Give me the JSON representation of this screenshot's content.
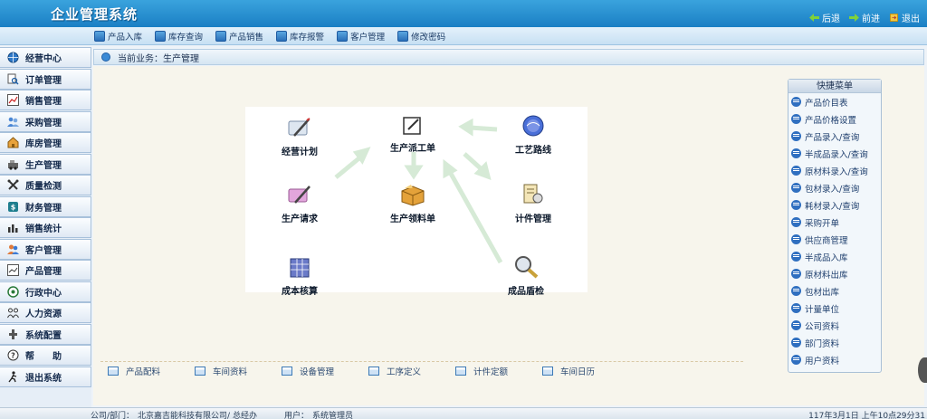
{
  "app": {
    "title": "企业管理系统"
  },
  "topnav": [
    {
      "label": "后退",
      "icon": "back-arrow-icon"
    },
    {
      "label": "前进",
      "icon": "forward-arrow-icon"
    },
    {
      "label": "退出",
      "icon": "exit-icon"
    }
  ],
  "toolbar": [
    {
      "label": "产品入库",
      "icon": "stock-in-icon"
    },
    {
      "label": "库存查询",
      "icon": "inventory-search-icon"
    },
    {
      "label": "产品销售",
      "icon": "sales-icon"
    },
    {
      "label": "库存报警",
      "icon": "inventory-alarm-icon"
    },
    {
      "label": "客户管理",
      "icon": "customer-icon"
    },
    {
      "label": "修改密码",
      "icon": "key-icon"
    }
  ],
  "sidebar": [
    {
      "label": "经营中心",
      "icon": "globe-icon"
    },
    {
      "label": "订单管理",
      "icon": "order-search-icon"
    },
    {
      "label": "销售管理",
      "icon": "sales-chart-icon"
    },
    {
      "label": "采购管理",
      "icon": "purchase-users-icon"
    },
    {
      "label": "库房管理",
      "icon": "warehouse-icon"
    },
    {
      "label": "生产管理",
      "icon": "production-icon"
    },
    {
      "label": "质量检测",
      "icon": "quality-check-icon"
    },
    {
      "label": "财务管理",
      "icon": "finance-icon"
    },
    {
      "label": "销售统计",
      "icon": "bar-chart-icon"
    },
    {
      "label": "客户管理",
      "icon": "customers-icon"
    },
    {
      "label": "产品管理",
      "icon": "product-chart-icon"
    },
    {
      "label": "行政中心",
      "icon": "admin-icon"
    },
    {
      "label": "人力资源",
      "icon": "hr-icon"
    },
    {
      "label": "系统配置",
      "icon": "config-icon"
    },
    {
      "label": "帮　　助",
      "icon": "help-icon"
    },
    {
      "label": "退出系统",
      "icon": "logout-icon"
    }
  ],
  "breadcrumb": {
    "prefix": "当前业务：",
    "current": "生产管理"
  },
  "flow": [
    {
      "label": "经营计划",
      "icon": "business-plan-icon"
    },
    {
      "label": "生产派工单",
      "icon": "dispatch-order-icon"
    },
    {
      "label": "工艺路线",
      "icon": "process-route-icon"
    },
    {
      "label": "生产请求",
      "icon": "production-request-icon"
    },
    {
      "label": "生产领料单",
      "icon": "material-requisition-icon"
    },
    {
      "label": "计件管理",
      "icon": "piecework-icon"
    },
    {
      "label": "成本核算",
      "icon": "cost-accounting-icon"
    },
    {
      "label": "成品盾检",
      "icon": "product-inspection-icon"
    }
  ],
  "bottom_links": [
    "产品配料",
    "车间资料",
    "设备管理",
    "工序定义",
    "计件定额",
    "车间日历"
  ],
  "quick_menu": {
    "title": "快捷菜单",
    "items": [
      "产品价目表",
      "产品价格设置",
      "产品录入/查询",
      "半成品录入/查询",
      "原材料录入/查询",
      "包材录入/查询",
      "耗材录入/查询",
      "采购开单",
      "供应商管理",
      "半成品入库",
      "原材料出库",
      "包材出库",
      "计量单位",
      "公司资料",
      "部门资料",
      "用户资料"
    ]
  },
  "status": {
    "company_label": "公司/部门：",
    "company": "北京嘉吉能科技有限公司/ 总经办",
    "user_label": "用户：",
    "user": "系统管理员",
    "datetime": "117年3月1日 上午10点29分31"
  },
  "colors": {
    "header": "#1a7fc4",
    "accent": "#2f6fc0"
  }
}
